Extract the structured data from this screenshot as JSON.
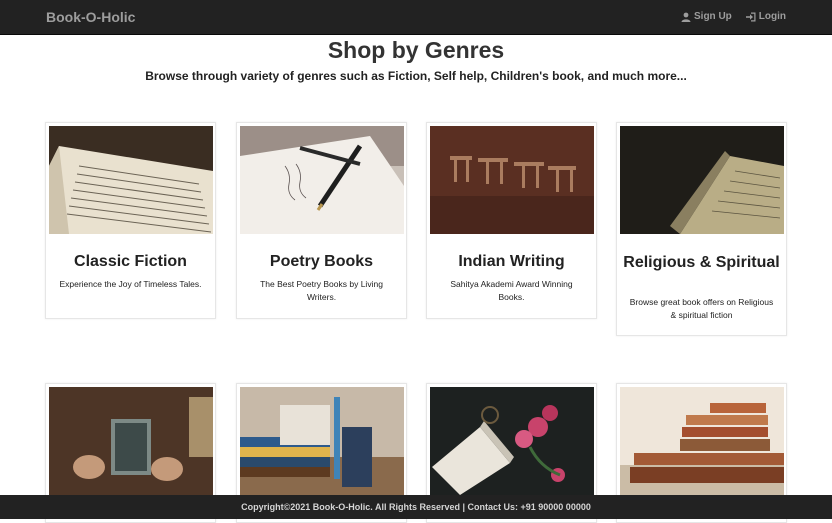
{
  "navbar": {
    "brand": "Book-O-Holic",
    "signup_label": "Sign Up",
    "login_label": "Login"
  },
  "header": {
    "title": "Shop by Genres",
    "subtitle": "Browse through variety of genres such as Fiction, Self help, Children's book, and much more..."
  },
  "genres": [
    {
      "title": "Classic Fiction",
      "desc": "Experience the Joy of Timeless Tales."
    },
    {
      "title": "Poetry Books",
      "desc": "The Best Poetry Books by Living Writers."
    },
    {
      "title": "Indian Writing",
      "desc": "Sahitya Akademi Award Winning Books."
    },
    {
      "title": "Religious & Spiritual",
      "desc": "Browse great book offers on Religious & spiritual fiction"
    }
  ],
  "footer": {
    "text": "Copyright©2021 Book-O-Holic. All Rights Reserved | Contact Us: +91 90000 00000"
  },
  "colors": {
    "navbar_bg": "#222222",
    "nav_text": "#9d9d9d",
    "footer_bg": "#222222"
  }
}
